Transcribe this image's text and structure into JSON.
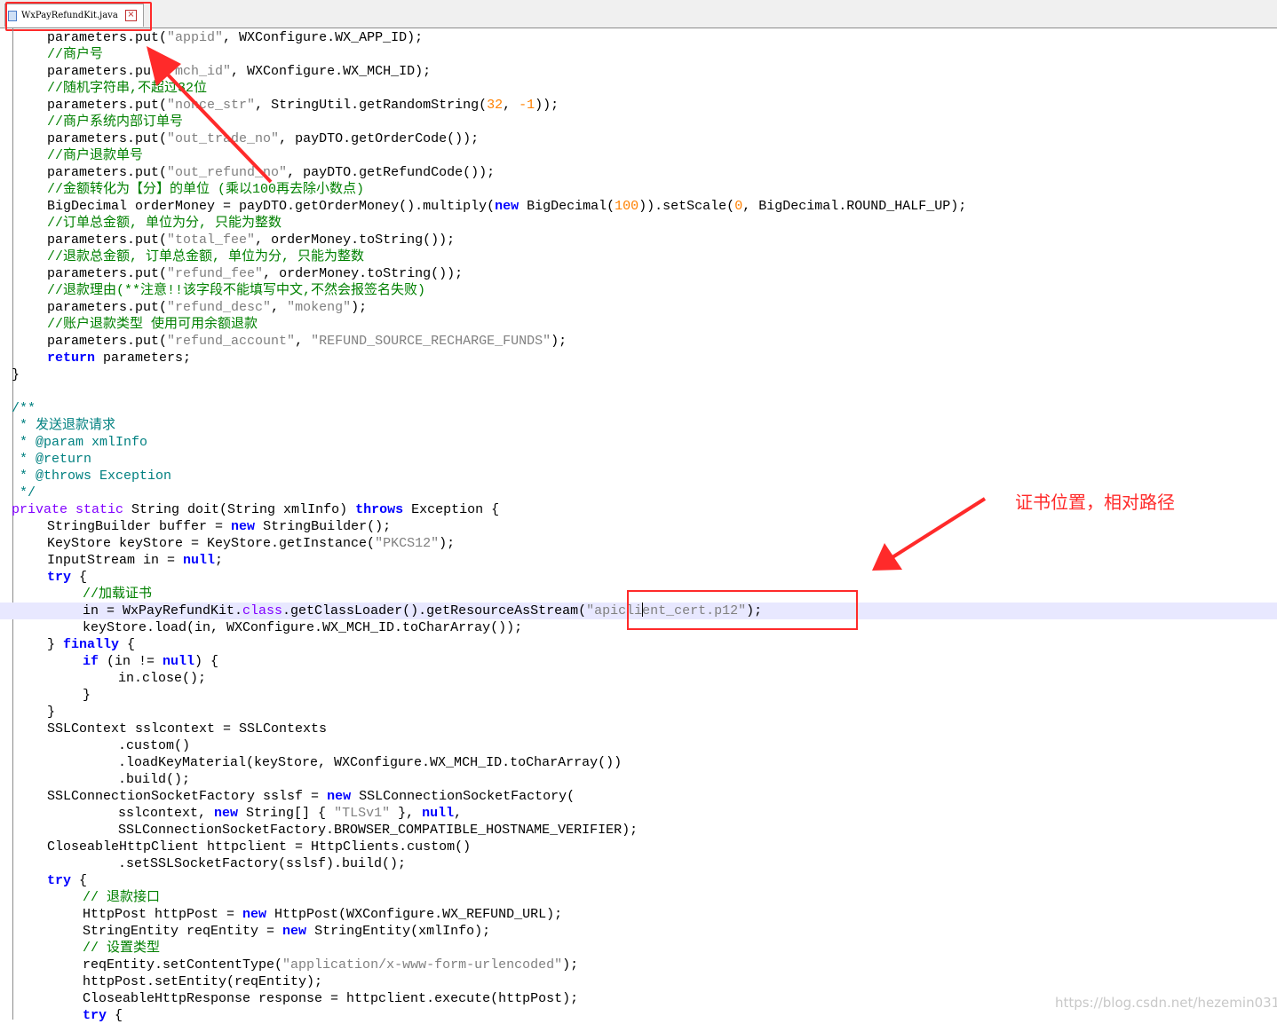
{
  "tab": {
    "title": "WxPayRefundKit.java",
    "close_glyph": "×"
  },
  "annotation": {
    "note": "证书位置，相对路径"
  },
  "watermark": "https://blog.csdn.net/hezemin0315",
  "colors": {
    "annotation": "#ff2a2a",
    "comment": "#008000",
    "keyword": "#0000ff",
    "string": "#808080",
    "number": "#ff8000",
    "current_line": "#e8e8ff"
  },
  "current_line_index": 34,
  "code_lines": [
    [
      [
        4,
        ""
      ],
      [
        "",
        "parameters.put("
      ],
      [
        "s",
        "\"appid\""
      ],
      [
        "",
        ", WXConfigure.WX_APP_ID);"
      ]
    ],
    [
      [
        4,
        ""
      ],
      [
        "c",
        "//商户号"
      ]
    ],
    [
      [
        4,
        ""
      ],
      [
        "",
        "parameters.put("
      ],
      [
        "s",
        "\"mch_id\""
      ],
      [
        "",
        ", WXConfigure.WX_MCH_ID);"
      ]
    ],
    [
      [
        4,
        ""
      ],
      [
        "c",
        "//随机字符串,不超过32位"
      ]
    ],
    [
      [
        4,
        ""
      ],
      [
        "",
        "parameters.put("
      ],
      [
        "s",
        "\"nonce_str\""
      ],
      [
        "",
        ", StringUtil.getRandomString("
      ],
      [
        "n",
        "32"
      ],
      [
        "",
        ", "
      ],
      [
        "n",
        "-1"
      ],
      [
        "",
        "));"
      ]
    ],
    [
      [
        4,
        ""
      ],
      [
        "c",
        "//商户系统内部订单号"
      ]
    ],
    [
      [
        4,
        ""
      ],
      [
        "",
        "parameters.put("
      ],
      [
        "s",
        "\"out_trade_no\""
      ],
      [
        "",
        ", payDTO.getOrderCode());"
      ]
    ],
    [
      [
        4,
        ""
      ],
      [
        "c",
        "//商户退款单号"
      ]
    ],
    [
      [
        4,
        ""
      ],
      [
        "",
        "parameters.put("
      ],
      [
        "s",
        "\"out_refund_no\""
      ],
      [
        "",
        ", payDTO.getRefundCode());"
      ]
    ],
    [
      [
        4,
        ""
      ],
      [
        "c",
        "//金额转化为【分】的单位 (乘以100再去除小数点)"
      ]
    ],
    [
      [
        4,
        ""
      ],
      [
        "",
        "BigDecimal orderMoney = payDTO.getOrderMoney().multiply("
      ],
      [
        "k",
        "new"
      ],
      [
        "",
        " BigDecimal("
      ],
      [
        "n",
        "100"
      ],
      [
        "",
        ")).setScale("
      ],
      [
        "n",
        "0"
      ],
      [
        "",
        ", BigDecimal.ROUND_HALF_UP);"
      ]
    ],
    [
      [
        4,
        ""
      ],
      [
        "c",
        "//订单总金额, 单位为分, 只能为整数"
      ]
    ],
    [
      [
        4,
        ""
      ],
      [
        "",
        "parameters.put("
      ],
      [
        "s",
        "\"total_fee\""
      ],
      [
        "",
        ", orderMoney.toString());"
      ]
    ],
    [
      [
        4,
        ""
      ],
      [
        "c",
        "//退款总金额, 订单总金额, 单位为分, 只能为整数"
      ]
    ],
    [
      [
        4,
        ""
      ],
      [
        "",
        "parameters.put("
      ],
      [
        "s",
        "\"refund_fee\""
      ],
      [
        "",
        ", orderMoney.toString());"
      ]
    ],
    [
      [
        4,
        ""
      ],
      [
        "c",
        "//退款理由(**注意!!该字段不能填写中文,不然会报签名失败)"
      ]
    ],
    [
      [
        4,
        ""
      ],
      [
        "",
        "parameters.put("
      ],
      [
        "s",
        "\"refund_desc\""
      ],
      [
        "",
        ", "
      ],
      [
        "s",
        "\"mokeng\""
      ],
      [
        "",
        ");"
      ]
    ],
    [
      [
        4,
        ""
      ],
      [
        "c",
        "//账户退款类型 使用可用余额退款"
      ]
    ],
    [
      [
        4,
        ""
      ],
      [
        "",
        "parameters.put("
      ],
      [
        "s",
        "\"refund_account\""
      ],
      [
        "",
        ", "
      ],
      [
        "s",
        "\"REFUND_SOURCE_RECHARGE_FUNDS\""
      ],
      [
        "",
        ");"
      ]
    ],
    [
      [
        4,
        ""
      ],
      [
        "k",
        "return"
      ],
      [
        "",
        " parameters;"
      ]
    ],
    [
      [
        0,
        ""
      ],
      [
        "",
        "}"
      ]
    ],
    [
      [
        0,
        ""
      ],
      [
        "",
        ""
      ]
    ],
    [
      [
        0,
        ""
      ],
      [
        "d",
        "/**"
      ]
    ],
    [
      [
        0,
        ""
      ],
      [
        "d",
        " * 发送退款请求"
      ]
    ],
    [
      [
        0,
        ""
      ],
      [
        "d",
        " * "
      ],
      [
        "d",
        "@param"
      ],
      [
        "d",
        " xmlInfo"
      ]
    ],
    [
      [
        0,
        ""
      ],
      [
        "d",
        " * "
      ],
      [
        "d",
        "@return"
      ]
    ],
    [
      [
        0,
        ""
      ],
      [
        "d",
        " * "
      ],
      [
        "d",
        "@throws"
      ],
      [
        "d",
        " Exception"
      ]
    ],
    [
      [
        0,
        ""
      ],
      [
        "d",
        " */"
      ]
    ],
    [
      [
        0,
        ""
      ],
      [
        "m",
        "private static"
      ],
      [
        "",
        " String doit(String xmlInfo) "
      ],
      [
        "k",
        "throws"
      ],
      [
        "",
        " Exception {"
      ]
    ],
    [
      [
        4,
        ""
      ],
      [
        "",
        "StringBuilder buffer = "
      ],
      [
        "k",
        "new"
      ],
      [
        "",
        " StringBuilder();"
      ]
    ],
    [
      [
        4,
        ""
      ],
      [
        "",
        "KeyStore keyStore = KeyStore.getInstance("
      ],
      [
        "s",
        "\"PKCS12\""
      ],
      [
        "",
        ");"
      ]
    ],
    [
      [
        4,
        ""
      ],
      [
        "",
        "InputStream in = "
      ],
      [
        "k",
        "null"
      ],
      [
        "",
        ";"
      ]
    ],
    [
      [
        4,
        ""
      ],
      [
        "k",
        "try"
      ],
      [
        "",
        " {"
      ]
    ],
    [
      [
        8,
        ""
      ],
      [
        "c",
        "//加载证书"
      ]
    ],
    [
      [
        8,
        ""
      ],
      [
        "",
        "in = WxPayRefundKit."
      ],
      [
        "m",
        "class"
      ],
      [
        "",
        ".getClassLoader().getResourceAsStream("
      ],
      [
        "s",
        "\"apicli"
      ],
      [
        "caret",
        ""
      ],
      [
        "s",
        "ent_cert.p12\""
      ],
      [
        "",
        ");"
      ]
    ],
    [
      [
        8,
        ""
      ],
      [
        "",
        "keyStore.load(in, WXConfigure.WX_MCH_ID.toCharArray());"
      ]
    ],
    [
      [
        4,
        ""
      ],
      [
        "",
        "} "
      ],
      [
        "k",
        "finally"
      ],
      [
        "",
        " {"
      ]
    ],
    [
      [
        8,
        ""
      ],
      [
        "k",
        "if"
      ],
      [
        "",
        " (in != "
      ],
      [
        "k",
        "null"
      ],
      [
        "",
        ") {"
      ]
    ],
    [
      [
        12,
        ""
      ],
      [
        "",
        "in.close();"
      ]
    ],
    [
      [
        8,
        ""
      ],
      [
        "",
        "}"
      ]
    ],
    [
      [
        4,
        ""
      ],
      [
        "",
        "}"
      ]
    ],
    [
      [
        4,
        ""
      ],
      [
        "",
        "SSLContext sslcontext = SSLContexts"
      ]
    ],
    [
      [
        12,
        ""
      ],
      [
        "",
        ".custom()"
      ]
    ],
    [
      [
        12,
        ""
      ],
      [
        "",
        ".loadKeyMaterial(keyStore, WXConfigure.WX_MCH_ID.toCharArray())"
      ]
    ],
    [
      [
        12,
        ""
      ],
      [
        "",
        ".build();"
      ]
    ],
    [
      [
        4,
        ""
      ],
      [
        "",
        "SSLConnectionSocketFactory sslsf = "
      ],
      [
        "k",
        "new"
      ],
      [
        "",
        " SSLConnectionSocketFactory("
      ]
    ],
    [
      [
        12,
        ""
      ],
      [
        "",
        "sslcontext, "
      ],
      [
        "k",
        "new"
      ],
      [
        "",
        " String[] { "
      ],
      [
        "s",
        "\"TLSv1\""
      ],
      [
        "",
        " }, "
      ],
      [
        "k",
        "null"
      ],
      [
        "",
        ","
      ]
    ],
    [
      [
        12,
        ""
      ],
      [
        "",
        "SSLConnectionSocketFactory.BROWSER_COMPATIBLE_HOSTNAME_VERIFIER);"
      ]
    ],
    [
      [
        4,
        ""
      ],
      [
        "",
        "CloseableHttpClient httpclient = HttpClients.custom()"
      ]
    ],
    [
      [
        12,
        ""
      ],
      [
        "",
        ".setSSLSocketFactory(sslsf).build();"
      ]
    ],
    [
      [
        4,
        ""
      ],
      [
        "k",
        "try"
      ],
      [
        "",
        " {"
      ]
    ],
    [
      [
        8,
        ""
      ],
      [
        "c",
        "// 退款接口"
      ]
    ],
    [
      [
        8,
        ""
      ],
      [
        "",
        "HttpPost httpPost = "
      ],
      [
        "k",
        "new"
      ],
      [
        "",
        " HttpPost(WXConfigure.WX_REFUND_URL);"
      ]
    ],
    [
      [
        8,
        ""
      ],
      [
        "",
        "StringEntity reqEntity = "
      ],
      [
        "k",
        "new"
      ],
      [
        "",
        " StringEntity(xmlInfo);"
      ]
    ],
    [
      [
        8,
        ""
      ],
      [
        "c",
        "// 设置类型"
      ]
    ],
    [
      [
        8,
        ""
      ],
      [
        "",
        "reqEntity.setContentType("
      ],
      [
        "s",
        "\"application/x-www-form-urlencoded\""
      ],
      [
        "",
        ");"
      ]
    ],
    [
      [
        8,
        ""
      ],
      [
        "",
        "httpPost.setEntity(reqEntity);"
      ]
    ],
    [
      [
        8,
        ""
      ],
      [
        "",
        "CloseableHttpResponse response = httpclient.execute(httpPost);"
      ]
    ],
    [
      [
        8,
        ""
      ],
      [
        "k",
        "try"
      ],
      [
        "",
        " {"
      ]
    ]
  ]
}
